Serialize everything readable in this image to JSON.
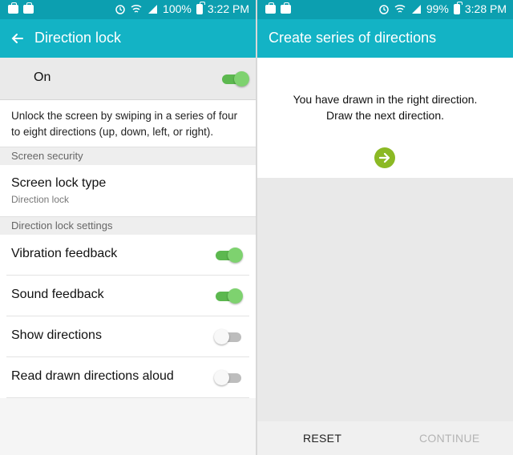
{
  "left": {
    "status": {
      "battery": "100%",
      "time": "3:22 PM"
    },
    "title": "Direction lock",
    "master_toggle": {
      "label": "On",
      "state": "on"
    },
    "description": "Unlock the screen by swiping in a series of four to eight directions (up, down, left, or right).",
    "section_security": "Screen security",
    "screen_lock": {
      "label": "Screen lock type",
      "value": "Direction lock"
    },
    "section_settings": "Direction lock settings",
    "settings": [
      {
        "label": "Vibration feedback",
        "state": "on"
      },
      {
        "label": "Sound feedback",
        "state": "on"
      },
      {
        "label": "Show directions",
        "state": "off"
      },
      {
        "label": "Read drawn directions aloud",
        "state": "off"
      }
    ]
  },
  "right": {
    "status": {
      "battery": "99%",
      "time": "3:28 PM"
    },
    "title": "Create series of directions",
    "message_line1": "You have drawn in the right direction.",
    "message_line2": "Draw the next direction.",
    "next_icon": "arrow-right-circle-icon",
    "reset_label": "RESET",
    "continue_label": "CONTINUE"
  },
  "colors": {
    "statusbar": "#0c9fb0",
    "appbar": "#13b3c5",
    "toggle_on": "#5cb84f",
    "arrow": "#8bb924"
  }
}
